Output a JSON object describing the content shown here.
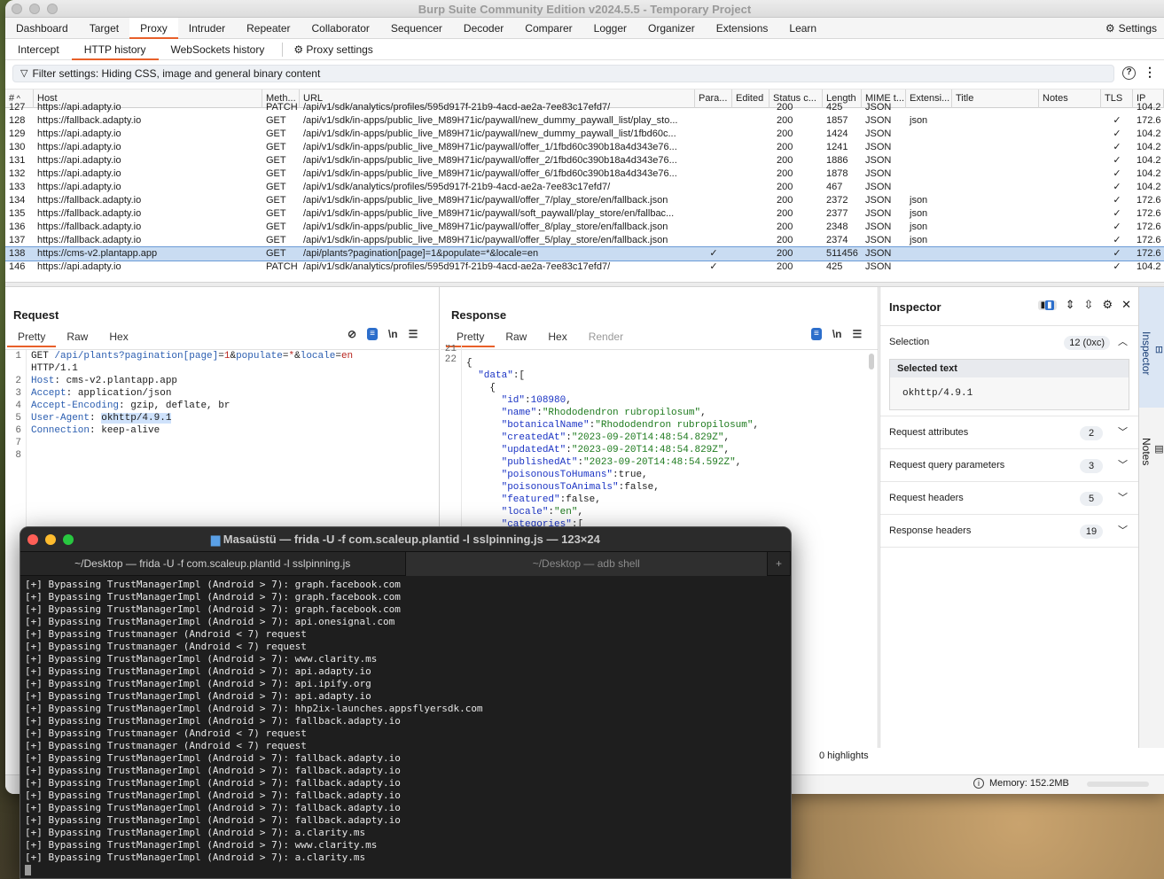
{
  "window_title": "Burp Suite Community Edition v2024.5.5 - Temporary Project",
  "menu": {
    "tabs": [
      "Dashboard",
      "Target",
      "Proxy",
      "Intruder",
      "Repeater",
      "Collaborator",
      "Sequencer",
      "Decoder",
      "Comparer",
      "Logger",
      "Organizer",
      "Extensions",
      "Learn"
    ],
    "active": "Proxy",
    "settings_label": "Settings"
  },
  "proxy_tabs": [
    "Intercept",
    "HTTP history",
    "WebSockets history"
  ],
  "proxy_settings_label": "Proxy settings",
  "filter_text": "Filter settings: Hiding CSS, image and general binary content",
  "table": {
    "columns": [
      "#",
      "Host",
      "Meth...",
      "URL",
      "Para...",
      "Edited",
      "Status c...",
      "Length",
      "MIME t...",
      "Extensi...",
      "Title",
      "Notes",
      "TLS",
      "IP"
    ],
    "partial_row": {
      "num": "127",
      "host": "https://api.adapty.io",
      "method": "PATCH",
      "url": "/api/v1/sdk/analytics/profiles/595d917f-21b9-4acd-ae2a-7ee83c17efd7/",
      "status": "200",
      "length": "425",
      "mime": "JSON",
      "ip": "104.2"
    },
    "rows": [
      {
        "num": "128",
        "host": "https://fallback.adapty.io",
        "method": "GET",
        "url": "/api/v1/sdk/in-apps/public_live_M89H71ic/paywall/new_dummy_paywall_list/play_sto...",
        "params": "",
        "status": "200",
        "length": "1857",
        "mime": "JSON",
        "ext": "json",
        "tls": "✓",
        "ip": "172.6"
      },
      {
        "num": "129",
        "host": "https://api.adapty.io",
        "method": "GET",
        "url": "/api/v1/sdk/in-apps/public_live_M89H71ic/paywall/new_dummy_paywall_list/1fbd60c...",
        "params": "",
        "status": "200",
        "length": "1424",
        "mime": "JSON",
        "ext": "",
        "tls": "✓",
        "ip": "104.2"
      },
      {
        "num": "130",
        "host": "https://api.adapty.io",
        "method": "GET",
        "url": "/api/v1/sdk/in-apps/public_live_M89H71ic/paywall/offer_1/1fbd60c390b18a4d343e76...",
        "params": "",
        "status": "200",
        "length": "1241",
        "mime": "JSON",
        "ext": "",
        "tls": "✓",
        "ip": "104.2"
      },
      {
        "num": "131",
        "host": "https://api.adapty.io",
        "method": "GET",
        "url": "/api/v1/sdk/in-apps/public_live_M89H71ic/paywall/offer_2/1fbd60c390b18a4d343e76...",
        "params": "",
        "status": "200",
        "length": "1886",
        "mime": "JSON",
        "ext": "",
        "tls": "✓",
        "ip": "104.2"
      },
      {
        "num": "132",
        "host": "https://api.adapty.io",
        "method": "GET",
        "url": "/api/v1/sdk/in-apps/public_live_M89H71ic/paywall/offer_6/1fbd60c390b18a4d343e76...",
        "params": "",
        "status": "200",
        "length": "1878",
        "mime": "JSON",
        "ext": "",
        "tls": "✓",
        "ip": "104.2"
      },
      {
        "num": "133",
        "host": "https://api.adapty.io",
        "method": "GET",
        "url": "/api/v1/sdk/analytics/profiles/595d917f-21b9-4acd-ae2a-7ee83c17efd7/",
        "params": "",
        "status": "200",
        "length": "467",
        "mime": "JSON",
        "ext": "",
        "tls": "✓",
        "ip": "104.2"
      },
      {
        "num": "134",
        "host": "https://fallback.adapty.io",
        "method": "GET",
        "url": "/api/v1/sdk/in-apps/public_live_M89H71ic/paywall/offer_7/play_store/en/fallback.json",
        "params": "",
        "status": "200",
        "length": "2372",
        "mime": "JSON",
        "ext": "json",
        "tls": "✓",
        "ip": "172.6"
      },
      {
        "num": "135",
        "host": "https://fallback.adapty.io",
        "method": "GET",
        "url": "/api/v1/sdk/in-apps/public_live_M89H71ic/paywall/soft_paywall/play_store/en/fallbac...",
        "params": "",
        "status": "200",
        "length": "2377",
        "mime": "JSON",
        "ext": "json",
        "tls": "✓",
        "ip": "172.6"
      },
      {
        "num": "136",
        "host": "https://fallback.adapty.io",
        "method": "GET",
        "url": "/api/v1/sdk/in-apps/public_live_M89H71ic/paywall/offer_8/play_store/en/fallback.json",
        "params": "",
        "status": "200",
        "length": "2348",
        "mime": "JSON",
        "ext": "json",
        "tls": "✓",
        "ip": "172.6"
      },
      {
        "num": "137",
        "host": "https://fallback.adapty.io",
        "method": "GET",
        "url": "/api/v1/sdk/in-apps/public_live_M89H71ic/paywall/offer_5/play_store/en/fallback.json",
        "params": "",
        "status": "200",
        "length": "2374",
        "mime": "JSON",
        "ext": "json",
        "tls": "✓",
        "ip": "172.6"
      },
      {
        "num": "138",
        "host": "https://cms-v2.plantapp.app",
        "method": "GET",
        "url": "/api/plants?pagination[page]=1&populate=*&locale=en",
        "params": "✓",
        "status": "200",
        "length": "511456",
        "mime": "JSON",
        "ext": "",
        "tls": "✓",
        "ip": "172.6",
        "selected": true
      },
      {
        "num": "146",
        "host": "https://api.adapty.io",
        "method": "PATCH",
        "url": "/api/v1/sdk/analytics/profiles/595d917f-21b9-4acd-ae2a-7ee83c17efd7/",
        "params": "✓",
        "status": "200",
        "length": "425",
        "mime": "JSON",
        "ext": "",
        "tls": "✓",
        "ip": "104.2"
      }
    ]
  },
  "request": {
    "title": "Request",
    "tabs": [
      "Pretty",
      "Raw",
      "Hex"
    ],
    "line_numbers": [
      "1",
      "",
      "2",
      "3",
      "4",
      "5",
      "6",
      "7",
      "8"
    ],
    "line1_method": "GET ",
    "line1_path": "/api/plants?",
    "line1_p1": "pagination[page]",
    "line1_v1": "1",
    "line1_p2": "populate",
    "line1_v2": "*",
    "line1_p3": "locale",
    "line1_v3": "en",
    "line1b": "HTTP/1.1",
    "headers": [
      {
        "name": "Host",
        "value": "cms-v2.plantapp.app"
      },
      {
        "name": "Accept",
        "value": "application/json"
      },
      {
        "name": "Accept-Encoding",
        "value": "gzip, deflate, br"
      },
      {
        "name": "User-Agent",
        "value": "okhttp/4.9.1"
      },
      {
        "name": "Connection",
        "value": "keep-alive"
      }
    ]
  },
  "response": {
    "title": "Response",
    "tabs": [
      "Pretty",
      "Raw",
      "Hex",
      "Render"
    ],
    "line_numbers": [
      "21",
      "22"
    ],
    "fields": [
      {
        "key": "\"id\"",
        "val": "108980",
        "type": "num"
      },
      {
        "key": "\"name\"",
        "val": "\"Rhododendron rubropilosum\"",
        "type": "str"
      },
      {
        "key": "\"botanicalName\"",
        "val": "\"Rhododendron rubropilosum\"",
        "type": "str"
      },
      {
        "key": "\"createdAt\"",
        "val": "\"2023-09-20T14:48:54.829Z\"",
        "type": "str"
      },
      {
        "key": "\"updatedAt\"",
        "val": "\"2023-09-20T14:48:54.829Z\"",
        "type": "str"
      },
      {
        "key": "\"publishedAt\"",
        "val": "\"2023-09-20T14:48:54.592Z\"",
        "type": "str"
      },
      {
        "key": "\"poisonousToHumans\"",
        "val": "true",
        "type": "kw"
      },
      {
        "key": "\"poisonousToAnimals\"",
        "val": "false",
        "type": "kw"
      },
      {
        "key": "\"featured\"",
        "val": "false",
        "type": "kw"
      },
      {
        "key": "\"locale\"",
        "val": "\"en\"",
        "type": "str"
      },
      {
        "key": "\"categories\"",
        "val": "[",
        "type": "plain"
      }
    ],
    "highlights": "0 highlights"
  },
  "inspector": {
    "title": "Inspector",
    "selection_label": "Selection",
    "selection_badge": "12 (0xc)",
    "selected_text_label": "Selected text",
    "selected_text": "okhttp/4.9.1",
    "sections": [
      {
        "label": "Request attributes",
        "count": "2"
      },
      {
        "label": "Request query parameters",
        "count": "3"
      },
      {
        "label": "Request headers",
        "count": "5"
      },
      {
        "label": "Response headers",
        "count": "19"
      }
    ]
  },
  "side_tabs": [
    "Inspector",
    "Notes"
  ],
  "memory": "Memory: 152.2MB",
  "terminal": {
    "title": "Masaüstü — frida -U -f com.scaleup.plantid -l sslpinning.js — 123×24",
    "tabs": [
      "~/Desktop — frida -U -f com.scaleup.plantid -l sslpinning.js",
      "~/Desktop — adb shell"
    ],
    "plus": "+",
    "lines": [
      "[+] Bypassing TrustManagerImpl (Android > 7): graph.facebook.com",
      "[+] Bypassing TrustManagerImpl (Android > 7): graph.facebook.com",
      "[+] Bypassing TrustManagerImpl (Android > 7): graph.facebook.com",
      "[+] Bypassing TrustManagerImpl (Android > 7): api.onesignal.com",
      "[+] Bypassing Trustmanager (Android < 7) request",
      "[+] Bypassing Trustmanager (Android < 7) request",
      "[+] Bypassing TrustManagerImpl (Android > 7): www.clarity.ms",
      "[+] Bypassing TrustManagerImpl (Android > 7): api.adapty.io",
      "[+] Bypassing TrustManagerImpl (Android > 7): api.ipify.org",
      "[+] Bypassing TrustManagerImpl (Android > 7): api.adapty.io",
      "[+] Bypassing TrustManagerImpl (Android > 7): hhp2ix-launches.appsflyersdk.com",
      "[+] Bypassing TrustManagerImpl (Android > 7): fallback.adapty.io",
      "[+] Bypassing Trustmanager (Android < 7) request",
      "[+] Bypassing Trustmanager (Android < 7) request",
      "[+] Bypassing TrustManagerImpl (Android > 7): fallback.adapty.io",
      "[+] Bypassing TrustManagerImpl (Android > 7): fallback.adapty.io",
      "[+] Bypassing TrustManagerImpl (Android > 7): fallback.adapty.io",
      "[+] Bypassing TrustManagerImpl (Android > 7): fallback.adapty.io",
      "[+] Bypassing TrustManagerImpl (Android > 7): fallback.adapty.io",
      "[+] Bypassing TrustManagerImpl (Android > 7): fallback.adapty.io",
      "[+] Bypassing TrustManagerImpl (Android > 7): a.clarity.ms",
      "[+] Bypassing TrustManagerImpl (Android > 7): www.clarity.ms",
      "[+] Bypassing TrustManagerImpl (Android > 7): a.clarity.ms"
    ]
  },
  "colors": {
    "accent": "#e8602a",
    "selection": "#c9dcf2",
    "blue": "#2c6ecb"
  }
}
